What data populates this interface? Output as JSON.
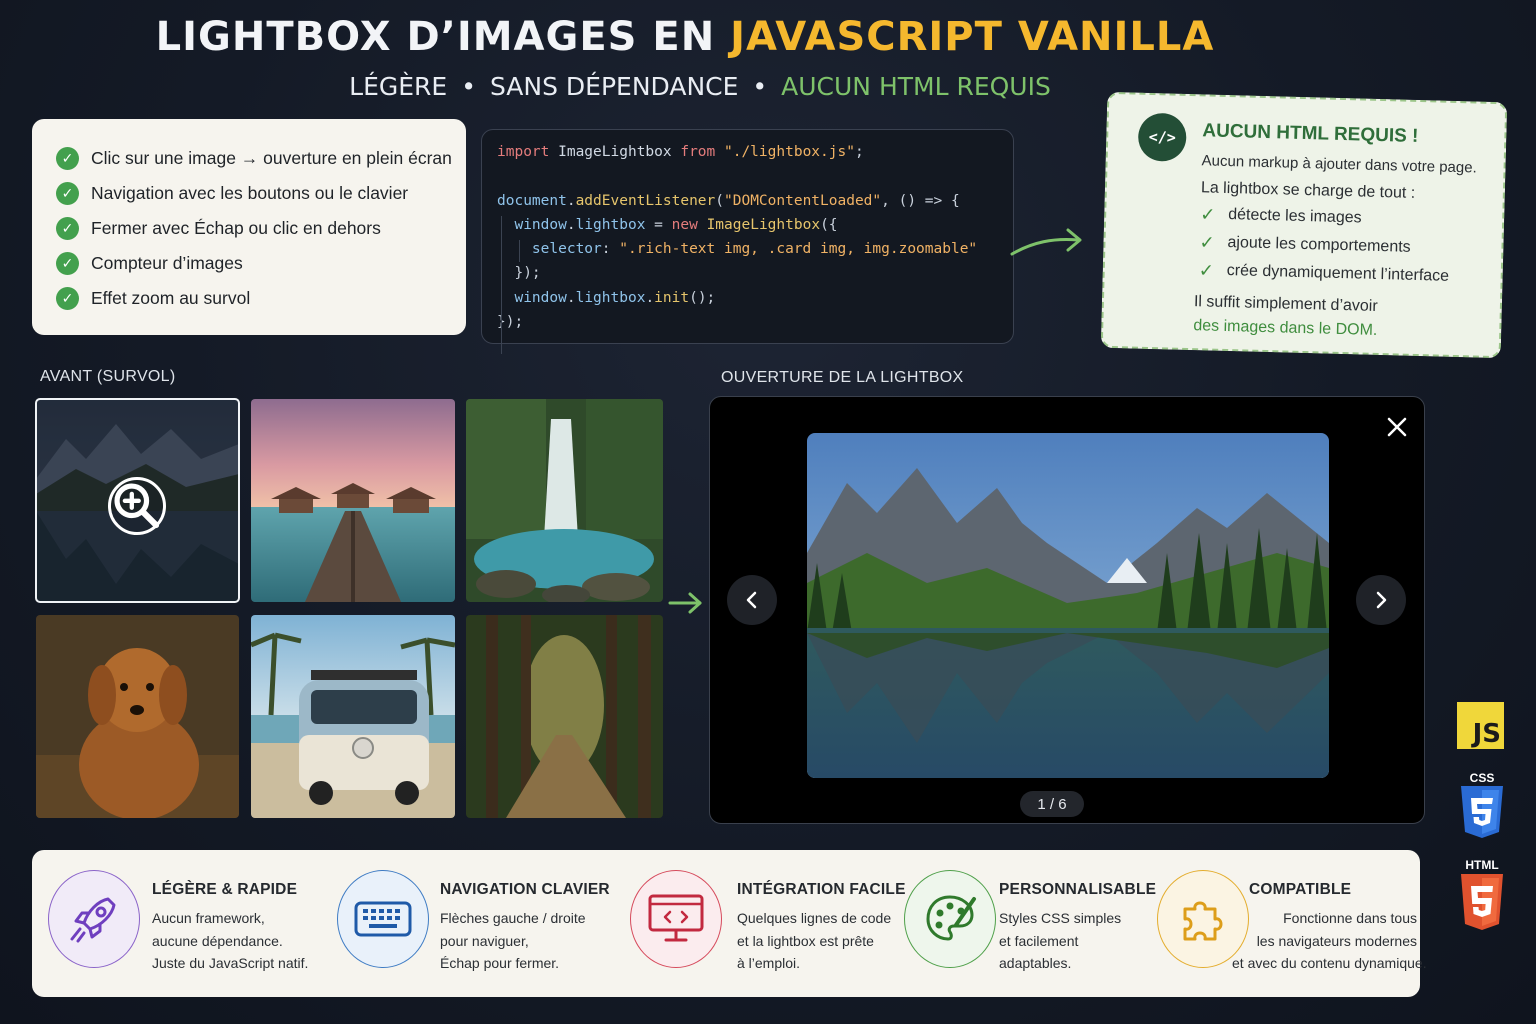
{
  "header": {
    "title_main": "LIGHTBOX D’IMAGES EN ",
    "title_accent": "JAVASCRIPT VANILLA",
    "subtitle_1": "LÉGÈRE",
    "subtitle_sep": "•",
    "subtitle_2": "SANS DÉPENDANCE",
    "subtitle_3": "AUCUN HTML REQUIS"
  },
  "checklist": [
    "Clic sur une image → ouverture en plein écran",
    "Navigation avec les boutons ou le clavier",
    "Fermer avec Échap ou clic en dehors",
    "Compteur d’images",
    "Effet zoom au survol"
  ],
  "code": {
    "l1_kw": "import",
    "l1_cls": " ImageLightbox ",
    "l1_kw2": "from",
    "l1_str": " \"./lightbox.js\"",
    "l1_end": ";",
    "l3_id": "document",
    "l3_dot": ".",
    "l3_fn": "addEventListener",
    "l3_open": "(",
    "l3_str": "\"DOMContentLoaded\"",
    "l3_rest": ", () => {",
    "l4_id": "window",
    "l4_dot": ".",
    "l4_prop": "lightbox",
    "l4_eq": " = ",
    "l4_kw": "new",
    "l4_cls": " ImageLightbox",
    "l4_end": "({",
    "l5_key": "selector",
    "l5_colon": ": ",
    "l5_str": "\".rich-text img, .card img, img.zoomable\"",
    "l6": "});",
    "l7_id": "window",
    "l7_dot": ".",
    "l7_prop": "lightbox",
    "l7_dot2": ".",
    "l7_fn": "init",
    "l7_end": "();",
    "l8": "});"
  },
  "note": {
    "icon": "</>",
    "title": "AUCUN HTML REQUIS !",
    "desc_1": "Aucun markup à ajouter dans votre page.",
    "desc_2": "La lightbox se charge de tout :",
    "items": [
      "détecte les images",
      "ajoute les comportements",
      "crée dynamiquement l’interface"
    ],
    "foot_1": "Il suffit simplement d’avoir",
    "foot_2": "des images dans le DOM."
  },
  "sections": {
    "before": "AVANT (SURVOL)",
    "lightbox": "OUVERTURE DE LA LIGHTBOX"
  },
  "lightbox": {
    "counter": "1 / 6"
  },
  "features": [
    {
      "title": "LÉGÈRE & RAPIDE",
      "lines": [
        "Aucun framework,",
        "aucune dépendance.",
        "Juste du JavaScript natif."
      ]
    },
    {
      "title": "NAVIGATION CLAVIER",
      "lines": [
        "Flèches gauche / droite",
        "pour naviguer,",
        "Échap pour fermer."
      ]
    },
    {
      "title": "INTÉGRATION FACILE",
      "lines": [
        "Quelques lignes de code",
        "et la lightbox est prête",
        "à l’emploi."
      ]
    },
    {
      "title": "PERSONNALISABLE",
      "lines": [
        "Styles CSS simples",
        "et facilement",
        "adaptables."
      ]
    },
    {
      "title": "COMPATIBLE",
      "lines": [
        "Fonctionne dans tous",
        "les navigateurs modernes",
        "et avec du contenu dynamique."
      ]
    }
  ],
  "badges": {
    "js": "JS",
    "css": "CSS",
    "html": "HTML"
  },
  "colors": {
    "accent_yellow": "#f5b82e",
    "accent_green": "#7ec26a",
    "check_green": "#43a04d"
  }
}
